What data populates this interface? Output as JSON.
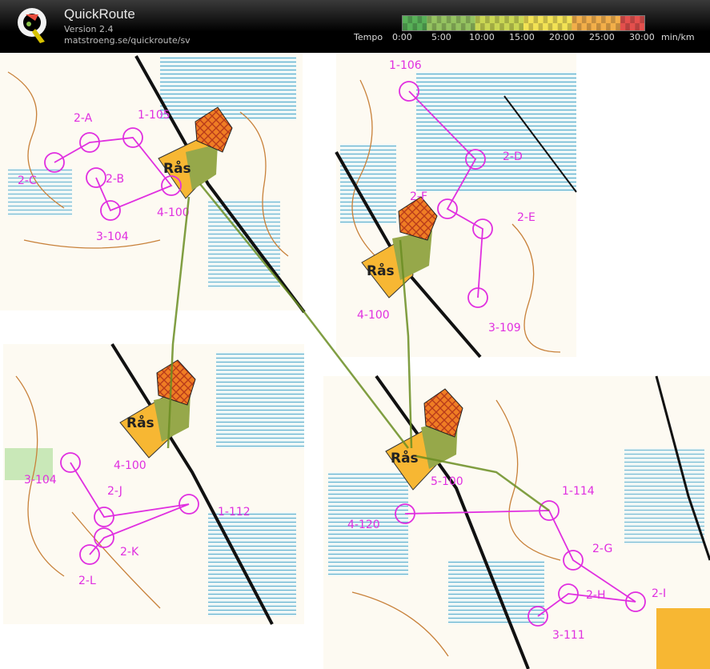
{
  "header": {
    "app_title": "QuickRoute",
    "version": "Version 2.4",
    "url": "matstroeng.se/quickroute/sv",
    "tempo_label": "Tempo",
    "unit": "min/km",
    "ticks": [
      "0:00",
      "5:00",
      "10:00",
      "15:00",
      "20:00",
      "25:00",
      "30:00"
    ],
    "scale_colors": [
      "#5cb85c",
      "#9ccc65",
      "#d4e157",
      "#ffee58",
      "#ffb74d",
      "#ef5350"
    ]
  },
  "map": {
    "colors": {
      "terrain": "#fdfaf2",
      "contour": "#c8813a",
      "marsh": "#3aa0c8",
      "green": "#7dc56b",
      "yellow": "#f7b733",
      "course": "#e02fe0",
      "route": "#6b8e23",
      "road": "#111111"
    },
    "finish_label": "Rås",
    "controls": {
      "p1": [
        "2-A",
        "1-105",
        "2-C",
        "2-B",
        "4-100",
        "3-104"
      ],
      "p2": [
        "1-106",
        "2-D",
        "2-F",
        "2-E",
        "4-100",
        "3-109"
      ],
      "p3": [
        "3-104",
        "4-100",
        "2-J",
        "1-112",
        "2-K",
        "2-L"
      ],
      "p4": [
        "5-100",
        "1-114",
        "4-120",
        "2-G",
        "2-H",
        "2-I",
        "3-111"
      ]
    }
  }
}
